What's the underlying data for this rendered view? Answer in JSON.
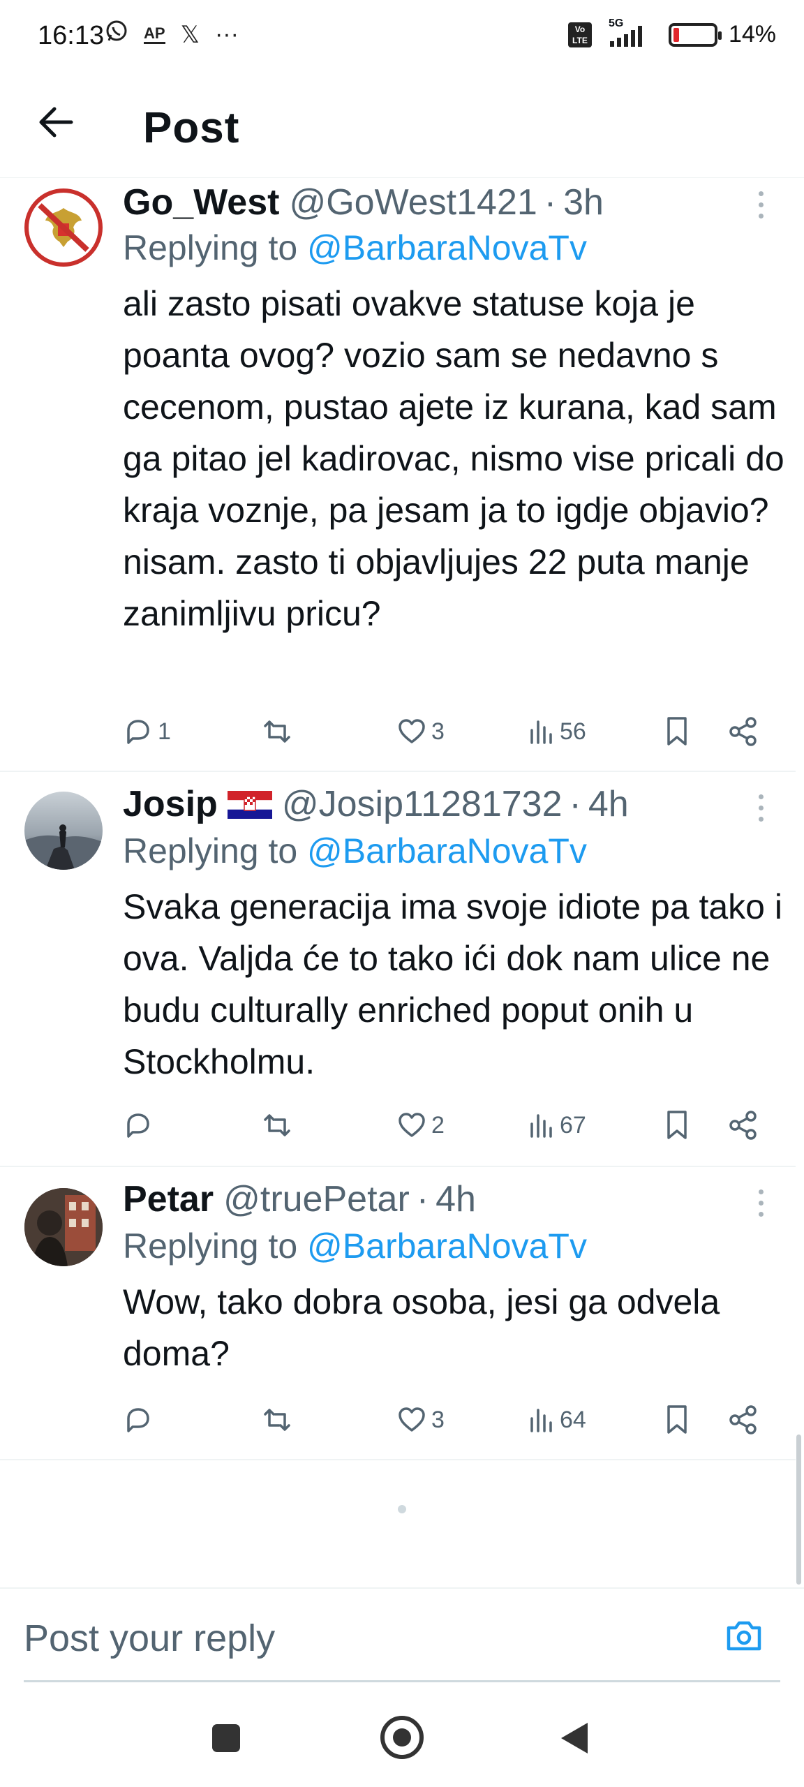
{
  "status_bar": {
    "time": "16:13",
    "left_icons": [
      "whatsapp-icon",
      "ap-news-icon",
      "x-icon",
      "more-notifications-icon"
    ],
    "ap_label": "AP",
    "x_label": "𝕏",
    "more_label": "···",
    "volte_label": "Vo LTE",
    "network": "5G",
    "battery_percent": "14%",
    "battery_level": 0.14
  },
  "header": {
    "title": "Post",
    "back_icon": "arrow-left-icon"
  },
  "posts": [
    {
      "name": "Go_West",
      "handle": "@GoWest1421",
      "separator": "·",
      "time": "3h",
      "replying_prefix": "Replying to ",
      "replying_to": "@BarbaraNovaTv",
      "text": "ali zasto pisati ovakve statuse koja je poanta ovog?  vozio sam se nedavno s cecenom, pustao ajete iz kurana, kad sam ga pitao jel kadirovac, nismo vise pricali do kraja voznje, pa jesam ja to igdje objavio? nisam. zasto ti objavljujes 22 puta manje zanimljivu pricu?",
      "replies": "1",
      "reposts": "",
      "likes": "3",
      "views": "56"
    },
    {
      "name": "Josip",
      "flag": "croatia-flag-icon",
      "handle": "@Josip11281732",
      "separator": "·",
      "time": "4h",
      "replying_prefix": "Replying to ",
      "replying_to": "@BarbaraNovaTv",
      "text": "Svaka generacija ima svoje idiote pa tako i ova. Valjda će to tako ići dok nam ulice ne budu culturally enriched poput onih u Stockholmu.",
      "replies": "",
      "reposts": "",
      "likes": "2",
      "views": "67"
    },
    {
      "name": "Petar",
      "handle": "@truePetar",
      "separator": "·",
      "time": "4h",
      "replying_prefix": "Replying to ",
      "replying_to": "@BarbaraNovaTv",
      "text": "Wow, tako dobra osoba, jesi ga odvela doma?",
      "replies": "",
      "reposts": "",
      "likes": "3",
      "views": "64"
    }
  ],
  "reply_bar": {
    "placeholder": "Post your reply",
    "camera_icon": "camera-icon"
  },
  "nav_bar": {
    "buttons": [
      "recents-square-icon",
      "home-circle-icon",
      "back-triangle-icon"
    ]
  },
  "colors": {
    "accent": "#1d9bf0",
    "secondary_text": "#536471",
    "primary_text": "#0f1419",
    "divider": "#eff3f4"
  }
}
